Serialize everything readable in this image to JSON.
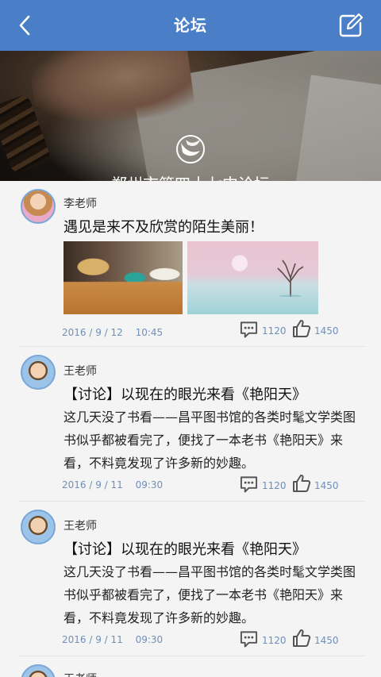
{
  "header": {
    "title": "论坛",
    "back_icon": "chevron-left-icon",
    "edit_icon": "edit-icon"
  },
  "banner": {
    "name": "郑州市第四十七中论坛"
  },
  "posts": [
    {
      "author": "李老师",
      "title": "遇见是来不及欣赏的陌生美丽！",
      "body": "",
      "date": "2016 / 9 / 12　 10:45",
      "comments": "1120",
      "likes": "1450",
      "has_images": true
    },
    {
      "author": "王老师",
      "title": "【讨论】以现在的眼光来看《艳阳天》",
      "body": "这几天没了书看——昌平图书馆的各类时髦文学类图书似乎都被看完了，便找了一本老书《艳阳天》来看，不料竟发现了许多新的妙趣。",
      "date": "2016 / 9 / 11　 09:30",
      "comments": "1120",
      "likes": "1450",
      "has_images": false
    },
    {
      "author": "王老师",
      "title": "【讨论】以现在的眼光来看《艳阳天》",
      "body": "这几天没了书看——昌平图书馆的各类时髦文学类图书似乎都被看完了，便找了一本老书《艳阳天》来看，不料竟发现了许多新的妙趣。",
      "date": "2016 / 9 / 11　 09:30",
      "comments": "1120",
      "likes": "1450",
      "has_images": false
    },
    {
      "author": "王老师"
    }
  ],
  "colors": {
    "header": "#4a7fc8",
    "meta": "#6f8fb8",
    "avatar_ring": "#7aa6d8"
  }
}
